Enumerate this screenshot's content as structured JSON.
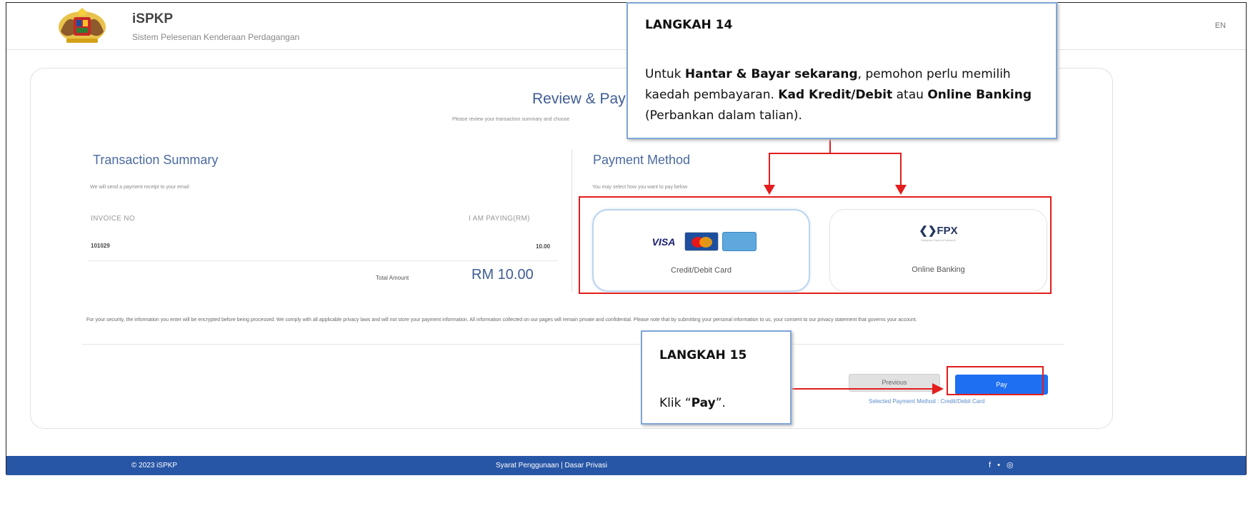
{
  "header": {
    "title": "iSPKP",
    "subtitle": "Sistem Pelesenan Kenderaan Perdagangan",
    "lang": "EN"
  },
  "review": {
    "title": "Review & Pay",
    "subtitle": "Please review your transaction summary and choose"
  },
  "summary": {
    "title": "Transaction Summary",
    "note": "We will send a payment receipt to your email",
    "col_invoice": "INVOICE NO",
    "col_paying": "I AM PAYING(RM)",
    "invoice_no": "101029",
    "amount": "10.00",
    "total_label": "Total Amount",
    "total_value": "RM 10.00"
  },
  "payment": {
    "title": "Payment Method",
    "note": "You may select how you want to pay below",
    "card_label": "Credit/Debit Card",
    "bank_label": "Online Banking",
    "visa": "VISA",
    "fpx": "FPX",
    "fpx_sub": "Malaysia Payment Network"
  },
  "security_text": "For your security, the information you enter will be encrypted before being processed. We comply with all applicable privacy laws and will not store your payment information. All information collected on our pages will remain private and confidential. Please note that by submitting your personal information to us, your consent to our privacy statement that governs your account.",
  "actions": {
    "previous": "Previous",
    "pay": "Pay",
    "selected_method": "Selected Payment Method : Credit/Debit Card"
  },
  "annotations": {
    "step14_title": "LANGKAH 14",
    "step14_body_1": "Untuk ",
    "step14_bold_1": "Hantar & Bayar sekarang",
    "step14_body_2": ", pemohon perlu memilih kaedah pembayaran. ",
    "step14_bold_2": "Kad Kredit/Debit",
    "step14_body_3": " atau ",
    "step14_bold_3": "Online Banking",
    "step14_body_4": " (Perbankan dalam talian).",
    "step15_title": "LANGKAH 15",
    "step15_body_1": "Klik “",
    "step15_bold": "Pay",
    "step15_body_2": "”."
  },
  "footer": {
    "copyright": "© 2023 iSPKP",
    "links": "Syarat Penggunaan | Dasar Privasi",
    "social": "f • ◎"
  },
  "colors": {
    "primary": "#1e6ff2",
    "footer": "#2856a6",
    "annotation_red": "#e31d1d",
    "callout_border": "#7ea6d8"
  }
}
